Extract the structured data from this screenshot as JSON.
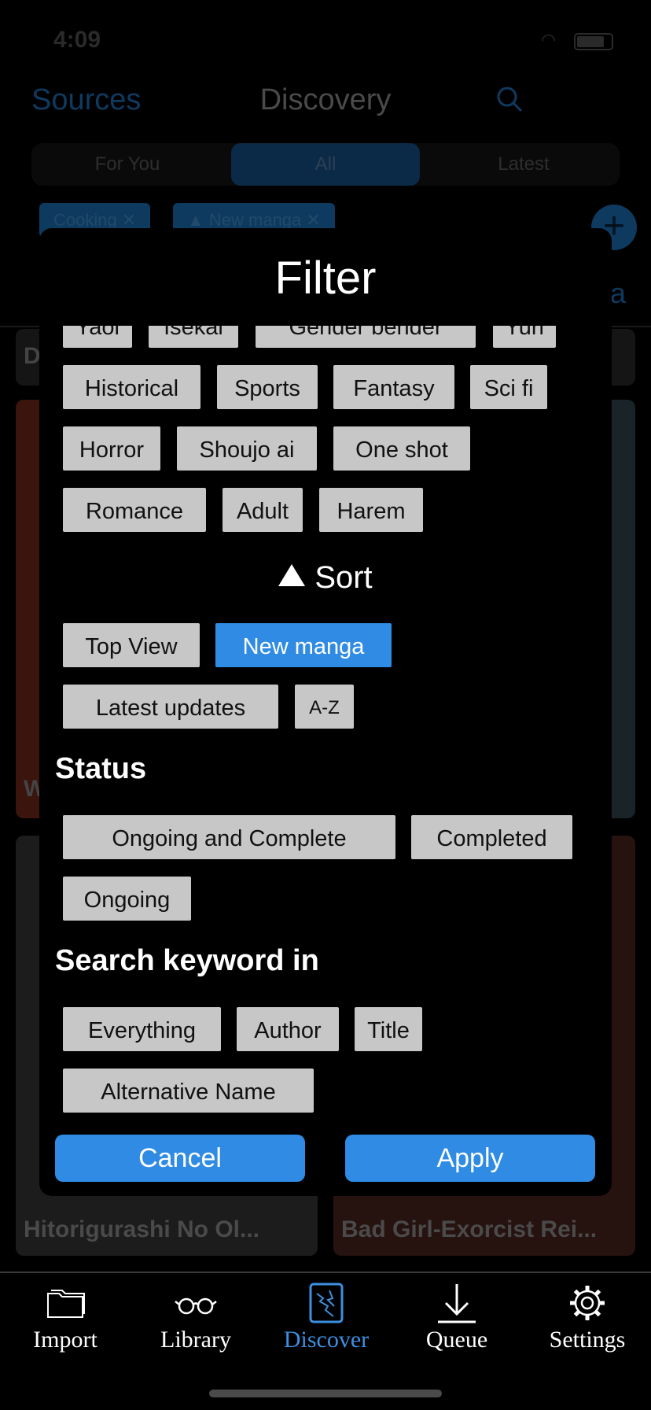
{
  "status": {
    "time": "4:09"
  },
  "nav": {
    "sources": "Sources",
    "title": "Discovery"
  },
  "segments": [
    "For You",
    "All",
    "Latest"
  ],
  "active_chips": [
    "Cooking",
    "▲ New manga"
  ],
  "bg_tab_partial": "ga",
  "cards": {
    "card_a_letter": "D",
    "card_c_letter": "W",
    "card_e_title": "Hitorigurashi No Ol...",
    "card_f_title": "Bad Girl-Exorcist Rei..."
  },
  "filter": {
    "title": "Filter",
    "genres_row0": [
      "Yaoi",
      "Isekai",
      "Gender bender",
      "Yuri"
    ],
    "genres_row1": [
      "Historical",
      "Sports",
      "Fantasy",
      "Sci fi"
    ],
    "genres_row2": [
      "Horror",
      "Shoujo ai",
      "One shot"
    ],
    "genres_row3": [
      "Romance",
      "Adult",
      "Harem"
    ],
    "sort_label": "Sort",
    "sort_options": [
      "Top View",
      "New manga",
      "Latest updates",
      "A-Z"
    ],
    "sort_selected": "New manga",
    "status_label": "Status",
    "status_options": [
      "Ongoing and Complete",
      "Completed",
      "Ongoing"
    ],
    "keyword_label": "Search keyword in",
    "keyword_options": [
      "Everything",
      "Author",
      "Title",
      "Alternative Name"
    ],
    "cancel": "Cancel",
    "apply": "Apply"
  },
  "tabbar": {
    "items": [
      {
        "label": "Import",
        "icon": "folder-icon"
      },
      {
        "label": "Library",
        "icon": "glasses-icon"
      },
      {
        "label": "Discover",
        "icon": "discover-icon"
      },
      {
        "label": "Queue",
        "icon": "download-icon"
      },
      {
        "label": "Settings",
        "icon": "gear-icon"
      }
    ],
    "active": "Discover"
  },
  "colors": {
    "accent": "#2f8be3",
    "chip": "#c7c7c7",
    "modal_bg": "#000000"
  }
}
